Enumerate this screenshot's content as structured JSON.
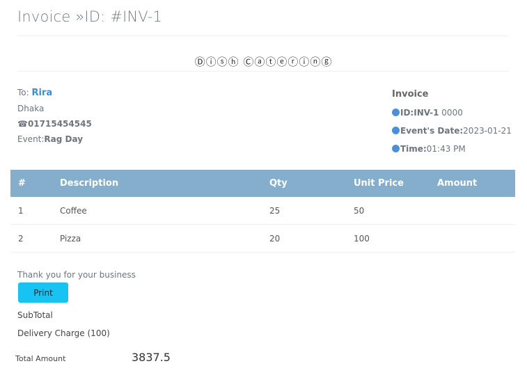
{
  "header": {
    "title": "Invoice »ID: #INV-1",
    "brand": "Ⓓⓘⓢⓗ Ⓒⓐⓣⓔⓡⓘⓝⓖ"
  },
  "bill_to": {
    "to_label": "To: ",
    "name": "Rira",
    "city": "Dhaka",
    "phone_icon": "☎",
    "phone": "01715454545",
    "event_label": "Event:",
    "event": "Rag Day"
  },
  "meta": {
    "heading": "Invoice",
    "id_label": "ID:INV-1",
    "id_value": " 0000",
    "date_label": "Event's Date:",
    "date_value": "2023-01-21",
    "time_label": "Time:",
    "time_value": "01:43 PM",
    "dot_color": "#4c8fd6"
  },
  "table": {
    "headers": {
      "num": "#",
      "description": "Description",
      "qty": "Qty",
      "unit_price": "Unit Price",
      "amount": "Amount"
    },
    "rows": [
      {
        "num": "1",
        "description": "Coffee",
        "qty": "25",
        "unit_price": "50",
        "amount": ""
      },
      {
        "num": "2",
        "description": "Pizza",
        "qty": "20",
        "unit_price": "100",
        "amount": ""
      }
    ],
    "header_color": "#84aecb"
  },
  "footer": {
    "thanks": "Thank you for your business",
    "print_label": "Print",
    "subtotal_label": "SubTotal",
    "delivery_label": "Delivery Charge (100)",
    "total_label": "Total Amount",
    "total_value": "3837.5",
    "print_color": "#17c3f2"
  }
}
